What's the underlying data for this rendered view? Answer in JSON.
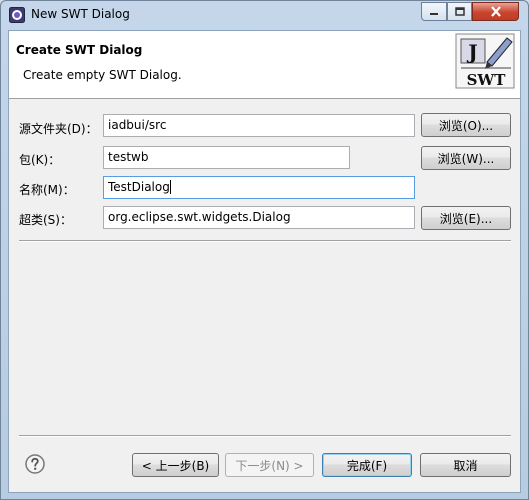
{
  "window": {
    "title": "New SWT Dialog",
    "icons": {
      "app": "eclipse-icon",
      "minimize": "minimize-icon",
      "maximize": "maximize-icon",
      "close": "close-icon"
    }
  },
  "banner": {
    "title": "Create SWT Dialog",
    "description": "Create empty SWT Dialog.",
    "logo": {
      "letters": "J",
      "text": "SWT",
      "icon": "swt-wizard-icon"
    }
  },
  "form": {
    "source_folder": {
      "label": "源文件夹(D)：",
      "value": "iadbui/src",
      "browse_label": "浏览(O)..."
    },
    "package": {
      "label": "包(K)：",
      "value": "testwb",
      "browse_label": "浏览(W)..."
    },
    "name": {
      "label": "名称(M)：",
      "value": "TestDialog"
    },
    "superclass": {
      "label": "超类(S)：",
      "value": "org.eclipse.swt.widgets.Dialog",
      "browse_label": "浏览(E)..."
    }
  },
  "footer": {
    "help_icon": "help-icon",
    "back_label": "< 上一步(B)",
    "next_label": "下一步(N) >",
    "finish_label": "完成(F)",
    "cancel_label": "取消"
  }
}
